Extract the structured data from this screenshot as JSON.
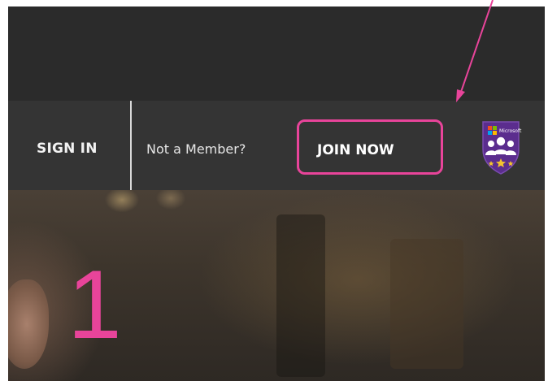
{
  "nav": {
    "sign_in_label": "SIGN IN",
    "member_prompt": "Not a Member?",
    "join_label": "JOIN NOW"
  },
  "badge": {
    "icon": "community-group-badge-icon",
    "brand_text": "Microsoft"
  },
  "annotation": {
    "step_number": "1",
    "color": "#e8449a"
  },
  "colors": {
    "top_bar": "#2b2b2b",
    "nav_bar": "#343434",
    "badge_purple": "#5b2d8e",
    "star_yellow": "#f2c230"
  }
}
